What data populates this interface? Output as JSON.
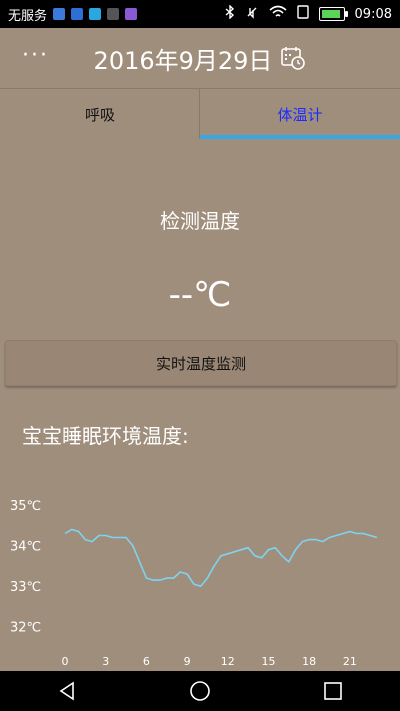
{
  "status_bar": {
    "carrier": "无服务",
    "time": "09:08",
    "battery_level": 0.9,
    "icons": [
      "app-icon-a",
      "app-icon-b",
      "usb-icon",
      "image-icon",
      "mail-icon",
      "bluetooth-icon",
      "mute-icon",
      "wifi-icon",
      "sim-icon",
      "battery-icon"
    ]
  },
  "header": {
    "menu_label": "···",
    "date": "2016年9月29日",
    "calendar_icon": "calendar-clock-icon"
  },
  "tabs": [
    {
      "label": "呼吸",
      "active": false
    },
    {
      "label": "体温计",
      "active": true
    }
  ],
  "main": {
    "detect_label": "检测温度",
    "temp_value": "--℃",
    "monitor_button": "实时温度监测",
    "env_label": "宝宝睡眠环境温度:"
  },
  "colors": {
    "background": "#A08E7C",
    "accent": "#39A7E6",
    "active_tab_text": "#1A2BFF",
    "line": "#7FD2F0"
  },
  "chart_data": {
    "type": "line",
    "y_ticks": [
      "35℃",
      "34℃",
      "33℃",
      "32℃"
    ],
    "x_ticks": [
      "0",
      "3",
      "6",
      "9",
      "12",
      "15",
      "18",
      "21"
    ],
    "ylim": [
      31.5,
      35.2
    ],
    "xlim": [
      0,
      23
    ],
    "x": [
      0,
      0.5,
      1,
      1.5,
      2,
      2.5,
      3,
      3.5,
      4,
      4.5,
      5,
      5.5,
      6,
      6.5,
      7,
      7.5,
      8,
      8.5,
      9,
      9.5,
      10,
      10.5,
      11,
      11.5,
      12,
      12.5,
      13,
      13.5,
      14,
      14.5,
      15,
      15.5,
      16,
      16.5,
      17,
      17.5,
      18,
      18.5,
      19,
      19.5,
      20,
      20.5,
      21,
      21.5,
      22,
      22.5,
      23
    ],
    "values": [
      34.3,
      34.4,
      34.35,
      34.15,
      34.1,
      34.25,
      34.25,
      34.2,
      34.2,
      34.2,
      34.0,
      33.6,
      33.2,
      33.15,
      33.15,
      33.2,
      33.2,
      33.35,
      33.3,
      33.05,
      33.0,
      33.2,
      33.5,
      33.75,
      33.8,
      33.85,
      33.9,
      33.95,
      33.75,
      33.7,
      33.9,
      33.95,
      33.75,
      33.6,
      33.9,
      34.1,
      34.15,
      34.15,
      34.1,
      34.2,
      34.25,
      34.3,
      34.35,
      34.3,
      34.3,
      34.25,
      34.2
    ],
    "grid": false
  },
  "nav_bar": {
    "icons": [
      "back-icon",
      "home-icon",
      "recent-apps-icon"
    ]
  }
}
